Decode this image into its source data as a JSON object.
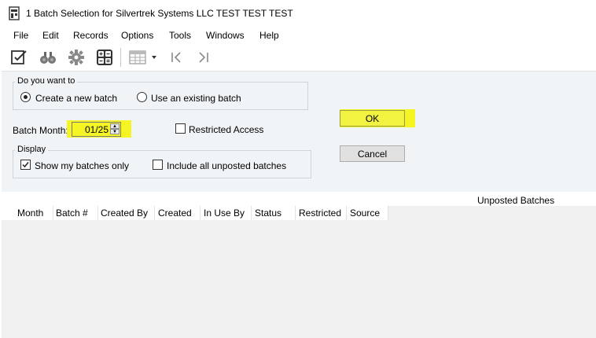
{
  "window": {
    "title": "1 Batch Selection for Silvertrek Systems LLC TEST TEST TEST"
  },
  "menu": {
    "items": [
      "File",
      "Edit",
      "Records",
      "Options",
      "Tools",
      "Windows",
      "Help"
    ]
  },
  "toolbar": {
    "icons": [
      "checklist-icon",
      "binoculars-icon",
      "gear-icon",
      "calculator-icon",
      "grid-view-icon",
      "dropdown-arrow-icon",
      "first-record-icon",
      "last-record-icon"
    ]
  },
  "form": {
    "question_group": {
      "legend": "Do you want to",
      "option_new": "Create a new batch",
      "option_existing": "Use an existing batch",
      "selected": "new"
    },
    "batch_month": {
      "label": "Batch Month:",
      "value": "01/25"
    },
    "restricted_access": {
      "label": "Restricted Access",
      "checked": false
    },
    "display_group": {
      "legend": "Display",
      "show_my_batches": {
        "label": "Show my batches only",
        "checked": true
      },
      "include_unposted": {
        "label": "Include all unposted batches",
        "checked": false
      }
    }
  },
  "buttons": {
    "ok": "OK",
    "cancel": "Cancel"
  },
  "grid": {
    "caption": "Unposted Batches",
    "columns": [
      "Month",
      "Batch #",
      "Created By",
      "Created",
      "In Use By",
      "Status",
      "Restricted",
      "Source"
    ]
  },
  "colors": {
    "highlight": "#f6f500",
    "dialog_bg": "#f0f4f7",
    "button_bg": "#e1e1e1"
  }
}
